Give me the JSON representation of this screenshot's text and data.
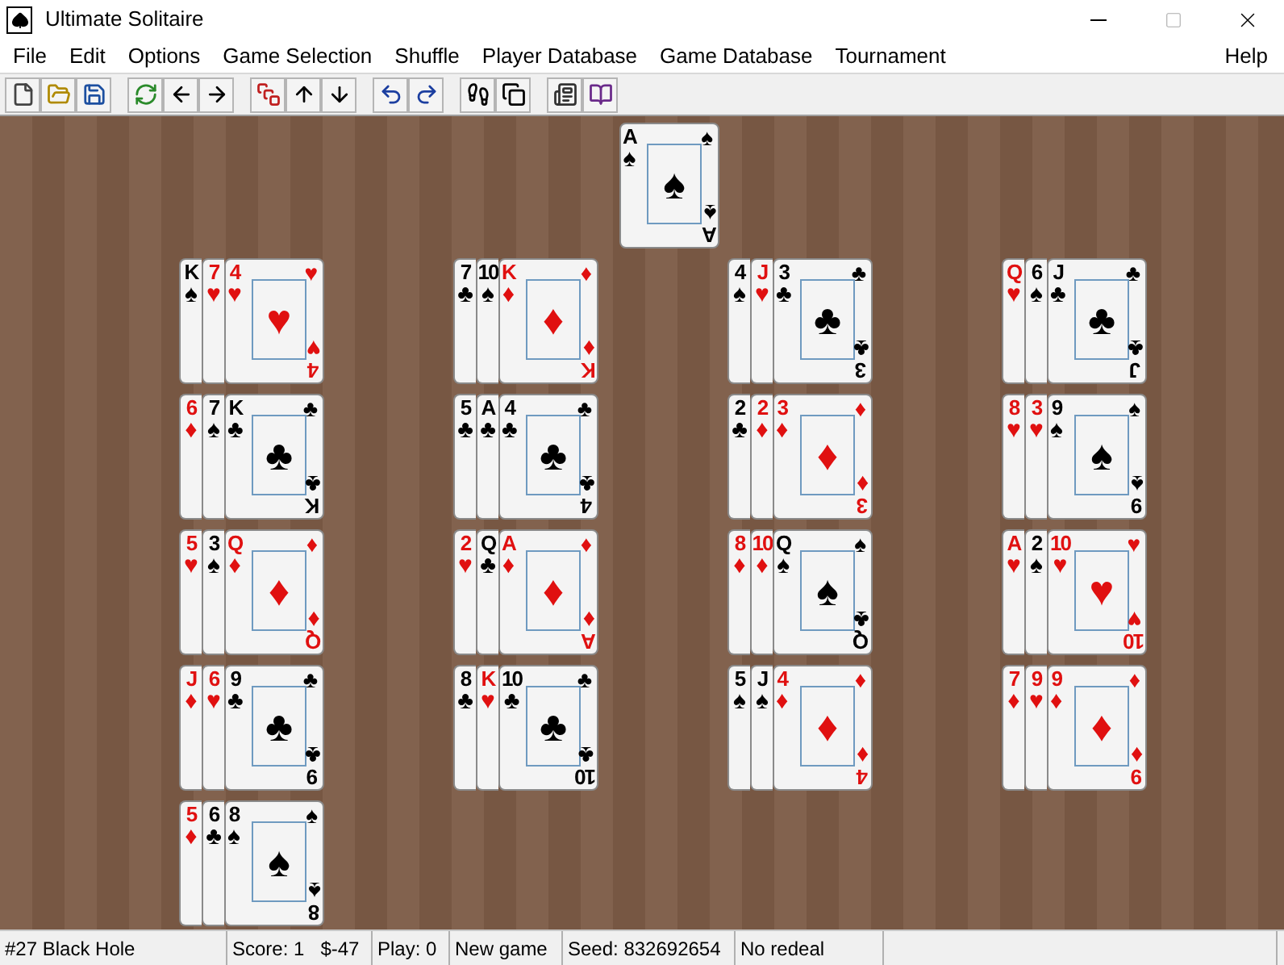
{
  "window": {
    "title": "Ultimate Solitaire"
  },
  "menu": [
    {
      "label": "File"
    },
    {
      "label": "Edit"
    },
    {
      "label": "Options"
    },
    {
      "label": "Game Selection"
    },
    {
      "label": "Shuffle"
    },
    {
      "label": "Player Database"
    },
    {
      "label": "Game Database"
    },
    {
      "label": "Tournament"
    }
  ],
  "help_menu": {
    "label": "Help"
  },
  "foundation": {
    "rank": "A",
    "suit": "♠",
    "corner_suit": "♠",
    "pip": "♠",
    "bottom_suit": "♠",
    "bottom_rank": "A",
    "red": false
  },
  "piles": [
    {
      "covered": [
        {
          "rank": "K",
          "suit": "♠",
          "red": false
        },
        {
          "rank": "7",
          "suit": "♥",
          "red": true
        }
      ],
      "top": {
        "rank": "4",
        "suit": "♥",
        "corner_suit": "♥",
        "pip": "♥",
        "bottom_suit": "♥",
        "bottom_rank": "4",
        "red": true
      }
    },
    {
      "covered": [
        {
          "rank": "7",
          "suit": "♣",
          "red": false
        },
        {
          "rank": "10",
          "suit": "♠",
          "red": false
        }
      ],
      "top": {
        "rank": "K",
        "suit": "♦",
        "corner_suit": "♦",
        "pip": "♦",
        "bottom_suit": "♦",
        "bottom_rank": "K",
        "red": true
      }
    },
    {
      "covered": [
        {
          "rank": "4",
          "suit": "♠",
          "red": false
        },
        {
          "rank": "J",
          "suit": "♥",
          "red": true
        }
      ],
      "top": {
        "rank": "3",
        "suit": "♣",
        "corner_suit": "♣",
        "pip": "♣",
        "bottom_suit": "♣",
        "bottom_rank": "3",
        "red": false
      }
    },
    {
      "covered": [
        {
          "rank": "Q",
          "suit": "♥",
          "red": true
        },
        {
          "rank": "6",
          "suit": "♠",
          "red": false
        }
      ],
      "top": {
        "rank": "J",
        "suit": "♣",
        "corner_suit": "♣",
        "pip": "♣",
        "bottom_suit": "♣",
        "bottom_rank": "J",
        "red": false
      }
    },
    {
      "covered": [
        {
          "rank": "6",
          "suit": "♦",
          "red": true
        },
        {
          "rank": "7",
          "suit": "♠",
          "red": false
        }
      ],
      "top": {
        "rank": "K",
        "suit": "♣",
        "corner_suit": "♣",
        "pip": "♣",
        "bottom_suit": "♣",
        "bottom_rank": "K",
        "red": false
      }
    },
    {
      "covered": [
        {
          "rank": "5",
          "suit": "♣",
          "red": false
        },
        {
          "rank": "A",
          "suit": "♣",
          "red": false
        }
      ],
      "top": {
        "rank": "4",
        "suit": "♣",
        "corner_suit": "♣",
        "pip": "♣",
        "bottom_suit": "♣",
        "bottom_rank": "4",
        "red": false
      }
    },
    {
      "covered": [
        {
          "rank": "2",
          "suit": "♣",
          "red": false
        },
        {
          "rank": "2",
          "suit": "♦",
          "red": true
        }
      ],
      "top": {
        "rank": "3",
        "suit": "♦",
        "corner_suit": "♦",
        "pip": "♦",
        "bottom_suit": "♦",
        "bottom_rank": "3",
        "red": true
      }
    },
    {
      "covered": [
        {
          "rank": "8",
          "suit": "♥",
          "red": true
        },
        {
          "rank": "3",
          "suit": "♥",
          "red": true
        }
      ],
      "top": {
        "rank": "9",
        "suit": "♠",
        "corner_suit": "♠",
        "pip": "♠",
        "bottom_suit": "♠",
        "bottom_rank": "9",
        "red": false
      }
    },
    {
      "covered": [
        {
          "rank": "5",
          "suit": "♥",
          "red": true
        },
        {
          "rank": "3",
          "suit": "♠",
          "red": false
        }
      ],
      "top": {
        "rank": "Q",
        "suit": "♦",
        "corner_suit": "♦",
        "pip": "♦",
        "bottom_suit": "♦",
        "bottom_rank": "Q",
        "red": true
      }
    },
    {
      "covered": [
        {
          "rank": "2",
          "suit": "♥",
          "red": true
        },
        {
          "rank": "Q",
          "suit": "♣",
          "red": false
        }
      ],
      "top": {
        "rank": "A",
        "suit": "♦",
        "corner_suit": "♦",
        "pip": "♦",
        "bottom_suit": "♦",
        "bottom_rank": "A",
        "red": true
      }
    },
    {
      "covered": [
        {
          "rank": "8",
          "suit": "♦",
          "red": true
        },
        {
          "rank": "10",
          "suit": "♦",
          "red": true
        }
      ],
      "top": {
        "rank": "Q",
        "suit": "♠",
        "corner_suit": "♠",
        "pip": "♠",
        "bottom_suit": "♣",
        "bottom_rank": "Q",
        "red": false
      }
    },
    {
      "covered": [
        {
          "rank": "A",
          "suit": "♥",
          "red": true
        },
        {
          "rank": "2",
          "suit": "♠",
          "red": false
        }
      ],
      "top": {
        "rank": "10",
        "suit": "♥",
        "corner_suit": "♥",
        "pip": "♥",
        "bottom_suit": "♥",
        "bottom_rank": "10",
        "red": true
      }
    },
    {
      "covered": [
        {
          "rank": "J",
          "suit": "♦",
          "red": true
        },
        {
          "rank": "6",
          "suit": "♥",
          "red": true
        }
      ],
      "top": {
        "rank": "9",
        "suit": "♣",
        "corner_suit": "♣",
        "pip": "♣",
        "bottom_suit": "♣",
        "bottom_rank": "9",
        "red": false
      }
    },
    {
      "covered": [
        {
          "rank": "8",
          "suit": "♣",
          "red": false
        },
        {
          "rank": "K",
          "suit": "♥",
          "red": true
        }
      ],
      "top": {
        "rank": "10",
        "suit": "♣",
        "corner_suit": "♣",
        "pip": "♣",
        "bottom_suit": "♣",
        "bottom_rank": "10",
        "red": false
      }
    },
    {
      "covered": [
        {
          "rank": "5",
          "suit": "♠",
          "red": false
        },
        {
          "rank": "J",
          "suit": "♠",
          "red": false
        }
      ],
      "top": {
        "rank": "4",
        "suit": "♦",
        "corner_suit": "♦",
        "pip": "♦",
        "bottom_suit": "♦",
        "bottom_rank": "4",
        "red": true
      }
    },
    {
      "covered": [
        {
          "rank": "7",
          "suit": "♦",
          "red": true
        },
        {
          "rank": "9",
          "suit": "♥",
          "red": true
        }
      ],
      "top": {
        "rank": "9",
        "suit": "♦",
        "corner_suit": "♦",
        "pip": "♦",
        "bottom_suit": "♦",
        "bottom_rank": "9",
        "red": true
      }
    },
    {
      "covered": [
        {
          "rank": "5",
          "suit": "♦",
          "red": true
        },
        {
          "rank": "6",
          "suit": "♣",
          "red": false
        }
      ],
      "top": {
        "rank": "8",
        "suit": "♠",
        "corner_suit": "♠",
        "pip": "♠",
        "bottom_suit": "♠",
        "bottom_rank": "8",
        "red": false
      }
    }
  ],
  "status_bar": [
    "#27 Black Hole",
    "Score: 1   $-47",
    "Play: 0",
    "New game",
    "Seed: 832692654",
    "No redeal"
  ]
}
